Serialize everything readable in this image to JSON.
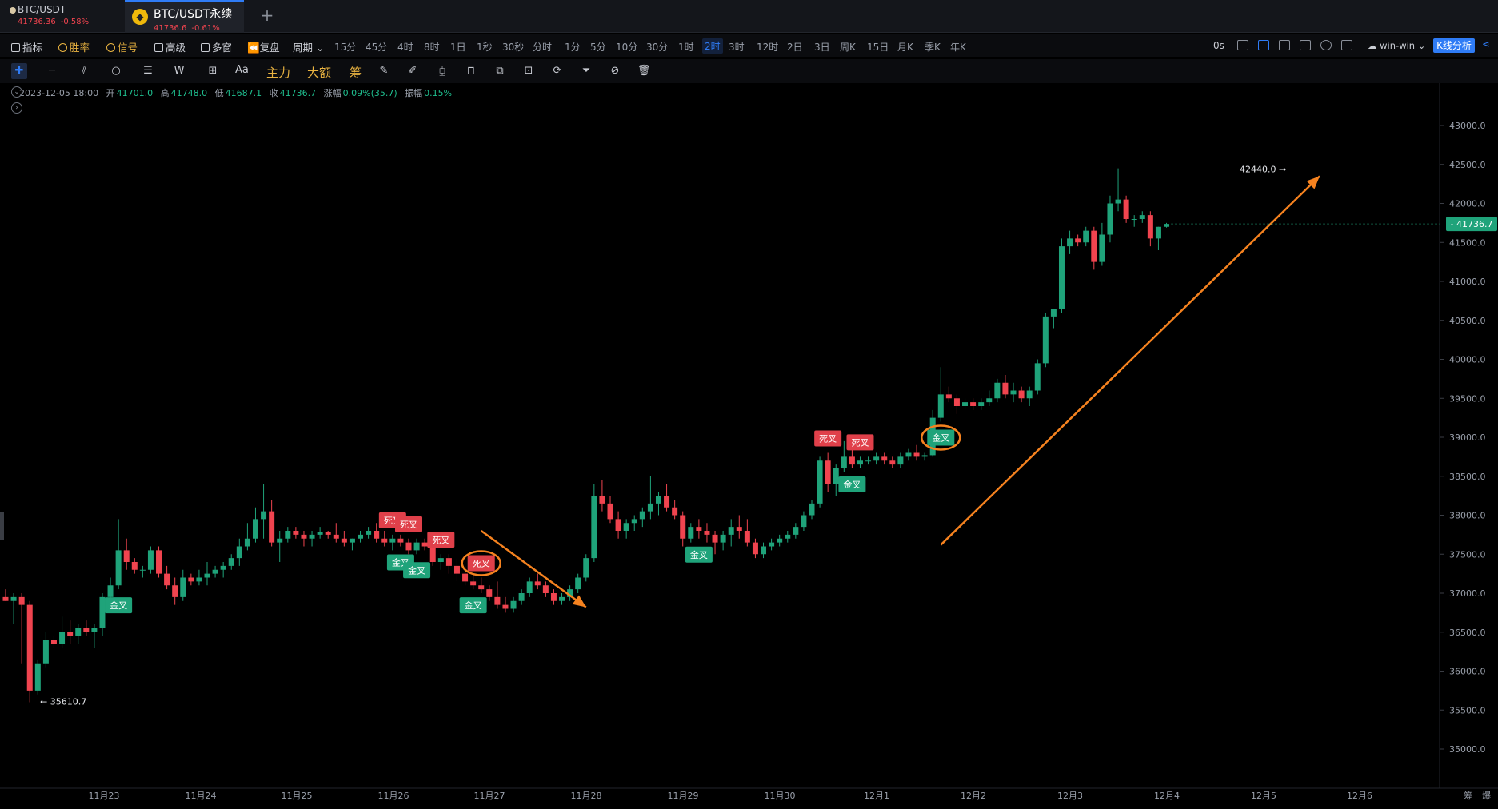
{
  "tabs": [
    {
      "name": "BTC/USDT",
      "price": "41736.36",
      "change": "-0.58%"
    },
    {
      "name": "BTC/USDT永续",
      "price": "41736.6",
      "change": "-0.61%"
    }
  ],
  "toolbar": {
    "indicators": "指标",
    "winrate": "胜率",
    "signal": "信号",
    "advanced": "高级",
    "multiwindow": "多窗",
    "replay": "复盘",
    "period": "周期",
    "intervals": [
      "15分",
      "45分",
      "4时",
      "8时",
      "1日",
      "1秒",
      "30秒",
      "分时",
      "1分",
      "5分",
      "10分",
      "30分",
      "1时",
      "2时",
      "3时",
      "12时",
      "2日",
      "3日",
      "周K",
      "15日",
      "月K",
      "季K",
      "年K"
    ],
    "active_interval": "2时",
    "latency": "0s",
    "user": "win-win",
    "kline_analysis": "K线分析"
  },
  "drawtools": {
    "text_tool": "Aa",
    "main_force": "主力",
    "big_order": "大额",
    "chips": "筹"
  },
  "ohlc": {
    "date": "2023-12-05 18:00",
    "open_label": "开",
    "open": "41701.0",
    "high_label": "高",
    "high": "41748.0",
    "low_label": "低",
    "low": "41687.1",
    "close_label": "收",
    "close": "41736.7",
    "change_label": "涨幅",
    "change": "0.09%(35.7)",
    "amp_label": "振幅",
    "amplitude": "0.15%"
  },
  "colors": {
    "up": "#1fa37a",
    "down": "#f0444f",
    "arrow": "#f5821f",
    "accent": "#2f7cf6"
  },
  "chart_data": {
    "type": "candlestick",
    "y_ticks": [
      43000.0,
      42500.0,
      42000.0,
      41500.0,
      41000.0,
      40500.0,
      40000.0,
      39500.0,
      39000.0,
      38500.0,
      38000.0,
      37500.0,
      37000.0,
      36500.0,
      36000.0,
      35500.0,
      35000.0
    ],
    "y_range": [
      34700,
      43500
    ],
    "x_labels": [
      "11月23",
      "11月24",
      "11月25",
      "11月26",
      "11月27",
      "11月28",
      "11月29",
      "11月30",
      "12月1",
      "12月2",
      "12月3",
      "12月4",
      "12月5",
      "12月6"
    ],
    "current_price": "41736.7",
    "high_marker": "42440.0 →",
    "low_marker": "← 35610.7",
    "candles": [
      [
        36950,
        37050,
        36900,
        36900
      ],
      [
        36900,
        37000,
        36600,
        36950
      ],
      [
        36950,
        37000,
        36100,
        36850
      ],
      [
        36850,
        36900,
        35600,
        35750
      ],
      [
        35750,
        36150,
        35700,
        36100
      ],
      [
        36100,
        36500,
        36050,
        36400
      ],
      [
        36400,
        36450,
        36300,
        36350
      ],
      [
        36350,
        36700,
        36300,
        36500
      ],
      [
        36500,
        36650,
        36350,
        36450
      ],
      [
        36450,
        36600,
        36350,
        36550
      ],
      [
        36550,
        36650,
        36450,
        36500
      ],
      [
        36500,
        36600,
        36300,
        36550
      ],
      [
        36550,
        37000,
        36450,
        36950
      ],
      [
        36950,
        37200,
        36850,
        37100
      ],
      [
        37100,
        37950,
        37050,
        37550
      ],
      [
        37550,
        37700,
        37300,
        37400
      ],
      [
        37400,
        37450,
        37250,
        37300
      ],
      [
        37300,
        37350,
        37200,
        37300
      ],
      [
        37300,
        37600,
        37250,
        37550
      ],
      [
        37550,
        37600,
        37200,
        37250
      ],
      [
        37250,
        37350,
        37050,
        37100
      ],
      [
        37100,
        37200,
        36850,
        36950
      ],
      [
        36950,
        37300,
        36900,
        37200
      ],
      [
        37200,
        37250,
        37100,
        37150
      ],
      [
        37150,
        37300,
        37100,
        37200
      ],
      [
        37200,
        37400,
        37100,
        37250
      ],
      [
        37250,
        37350,
        37200,
        37300
      ],
      [
        37300,
        37400,
        37200,
        37350
      ],
      [
        37350,
        37500,
        37300,
        37450
      ],
      [
        37450,
        37700,
        37350,
        37600
      ],
      [
        37600,
        37900,
        37550,
        37700
      ],
      [
        37700,
        38100,
        37650,
        37950
      ],
      [
        37950,
        38400,
        37700,
        38050
      ],
      [
        38050,
        38200,
        37600,
        37650
      ],
      [
        37650,
        37800,
        37400,
        37700
      ],
      [
        37700,
        37850,
        37650,
        37800
      ],
      [
        37800,
        37850,
        37700,
        37750
      ],
      [
        37750,
        37800,
        37600,
        37700
      ],
      [
        37700,
        37800,
        37600,
        37750
      ],
      [
        37750,
        37850,
        37700,
        37780
      ],
      [
        37780,
        37800,
        37700,
        37750
      ],
      [
        37750,
        37900,
        37650,
        37700
      ],
      [
        37700,
        37800,
        37600,
        37650
      ],
      [
        37650,
        37700,
        37550,
        37700
      ],
      [
        37700,
        37800,
        37650,
        37750
      ],
      [
        37750,
        37850,
        37700,
        37800
      ],
      [
        37800,
        37900,
        37650,
        37700
      ],
      [
        37700,
        37800,
        37600,
        37650
      ],
      [
        37650,
        37750,
        37550,
        37700
      ],
      [
        37700,
        37750,
        37600,
        37650
      ],
      [
        37650,
        37700,
        37500,
        37550
      ],
      [
        37550,
        37700,
        37500,
        37650
      ],
      [
        37650,
        37700,
        37550,
        37600
      ],
      [
        37600,
        37650,
        37350,
        37400
      ],
      [
        37400,
        37500,
        37300,
        37450
      ],
      [
        37450,
        37500,
        37250,
        37350
      ],
      [
        37350,
        37450,
        37150,
        37250
      ],
      [
        37250,
        37350,
        37100,
        37150
      ],
      [
        37150,
        37250,
        37050,
        37100
      ],
      [
        37100,
        37200,
        37000,
        37050
      ],
      [
        37050,
        37100,
        36900,
        36950
      ],
      [
        36950,
        37150,
        36800,
        36850
      ],
      [
        36850,
        36950,
        36750,
        36800
      ],
      [
        36800,
        36950,
        36750,
        36900
      ],
      [
        36900,
        37050,
        36850,
        37000
      ],
      [
        37000,
        37200,
        36950,
        37150
      ],
      [
        37150,
        37250,
        37050,
        37100
      ],
      [
        37100,
        37150,
        36950,
        37000
      ],
      [
        37000,
        37050,
        36850,
        36900
      ],
      [
        36900,
        37000,
        36850,
        36950
      ],
      [
        36950,
        37100,
        36900,
        37050
      ],
      [
        37050,
        37250,
        37000,
        37200
      ],
      [
        37200,
        37500,
        37150,
        37450
      ],
      [
        37450,
        38400,
        37400,
        38250
      ],
      [
        38250,
        38450,
        38050,
        38150
      ],
      [
        38150,
        38250,
        37900,
        37950
      ],
      [
        37950,
        38050,
        37700,
        37800
      ],
      [
        37800,
        37950,
        37700,
        37900
      ],
      [
        37900,
        38000,
        37800,
        37950
      ],
      [
        37950,
        38100,
        37850,
        38050
      ],
      [
        38050,
        38500,
        37950,
        38150
      ],
      [
        38150,
        38300,
        38000,
        38250
      ],
      [
        38250,
        38400,
        38050,
        38100
      ],
      [
        38100,
        38200,
        37950,
        38000
      ],
      [
        38000,
        38050,
        37600,
        37700
      ],
      [
        37700,
        37900,
        37650,
        37850
      ],
      [
        37850,
        37950,
        37700,
        37800
      ],
      [
        37800,
        37900,
        37650,
        37750
      ],
      [
        37750,
        37800,
        37500,
        37650
      ],
      [
        37650,
        37800,
        37550,
        37750
      ],
      [
        37750,
        37950,
        37600,
        37850
      ],
      [
        37850,
        38000,
        37700,
        37800
      ],
      [
        37800,
        37950,
        37600,
        37650
      ],
      [
        37650,
        37700,
        37450,
        37500
      ],
      [
        37500,
        37650,
        37450,
        37600
      ],
      [
        37600,
        37700,
        37550,
        37650
      ],
      [
        37650,
        37750,
        37600,
        37700
      ],
      [
        37700,
        37800,
        37650,
        37750
      ],
      [
        37750,
        37900,
        37700,
        37850
      ],
      [
        37850,
        38050,
        37800,
        38000
      ],
      [
        38000,
        38200,
        37950,
        38150
      ],
      [
        38150,
        38750,
        38100,
        38700
      ],
      [
        38700,
        38800,
        38300,
        38400
      ],
      [
        38400,
        38650,
        38250,
        38600
      ],
      [
        38600,
        38950,
        38550,
        38750
      ],
      [
        38750,
        38850,
        38600,
        38650
      ],
      [
        38650,
        38750,
        38600,
        38700
      ],
      [
        38700,
        38750,
        38650,
        38700
      ],
      [
        38700,
        38800,
        38650,
        38750
      ],
      [
        38750,
        38800,
        38650,
        38700
      ],
      [
        38700,
        38750,
        38600,
        38650
      ],
      [
        38650,
        38800,
        38600,
        38750
      ],
      [
        38750,
        38850,
        38700,
        38800
      ],
      [
        38800,
        38900,
        38700,
        38750
      ],
      [
        38750,
        38800,
        38700,
        38770
      ],
      [
        38770,
        39350,
        38750,
        39250
      ],
      [
        39250,
        39900,
        39200,
        39550
      ],
      [
        39550,
        39650,
        39450,
        39500
      ],
      [
        39500,
        39550,
        39300,
        39400
      ],
      [
        39400,
        39500,
        39350,
        39450
      ],
      [
        39450,
        39500,
        39350,
        39400
      ],
      [
        39400,
        39500,
        39350,
        39450
      ],
      [
        39450,
        39600,
        39400,
        39500
      ],
      [
        39500,
        39750,
        39450,
        39700
      ],
      [
        39700,
        39800,
        39500,
        39550
      ],
      [
        39550,
        39700,
        39450,
        39600
      ],
      [
        39600,
        39650,
        39450,
        39500
      ],
      [
        39500,
        39650,
        39400,
        39600
      ],
      [
        39600,
        40000,
        39550,
        39950
      ],
      [
        39950,
        40600,
        39900,
        40550
      ],
      [
        40550,
        40650,
        40400,
        40650
      ],
      [
        40650,
        41550,
        40600,
        41450
      ],
      [
        41450,
        41650,
        41350,
        41550
      ],
      [
        41550,
        41600,
        41450,
        41500
      ],
      [
        41500,
        41700,
        41450,
        41650
      ],
      [
        41650,
        41700,
        41150,
        41250
      ],
      [
        41250,
        41750,
        41200,
        41600
      ],
      [
        41600,
        42100,
        41500,
        42000
      ],
      [
        42000,
        42450,
        41900,
        42050
      ],
      [
        42050,
        42100,
        41750,
        41800
      ],
      [
        41800,
        41850,
        41700,
        41800
      ],
      [
        41800,
        41900,
        41750,
        41850
      ],
      [
        41850,
        41900,
        41450,
        41550
      ],
      [
        41550,
        41700,
        41400,
        41700
      ],
      [
        41700,
        41750,
        41690,
        41737
      ]
    ],
    "signals": [
      {
        "type": "gold",
        "label": "金叉",
        "index": 14
      },
      {
        "type": "death",
        "label": "死叉",
        "index": 48
      },
      {
        "type": "death",
        "label": "死叉",
        "index": 50
      },
      {
        "type": "gold",
        "label": "金叉",
        "index": 49
      },
      {
        "type": "gold",
        "label": "金叉",
        "index": 51
      },
      {
        "type": "death",
        "label": "死叉",
        "index": 54
      },
      {
        "type": "death",
        "label": "死叉",
        "index": 59,
        "circled": true
      },
      {
        "type": "gold",
        "label": "金叉",
        "index": 58
      },
      {
        "type": "gold",
        "label": "金叉",
        "index": 86
      },
      {
        "type": "death",
        "label": "死叉",
        "index": 102
      },
      {
        "type": "death",
        "label": "死叉",
        "index": 106
      },
      {
        "type": "gold",
        "label": "金叉",
        "index": 105
      },
      {
        "type": "gold",
        "label": "金叉",
        "index": 116,
        "circled": true
      }
    ],
    "arrows": [
      {
        "from_index": 59,
        "from_price": 37800,
        "to_index": 72,
        "to_price": 36820
      },
      {
        "from_index": 116,
        "from_price": 37620,
        "to_index": 163,
        "to_price": 42350
      }
    ],
    "grid": false,
    "scale_corner": [
      "筹",
      "爆"
    ]
  }
}
